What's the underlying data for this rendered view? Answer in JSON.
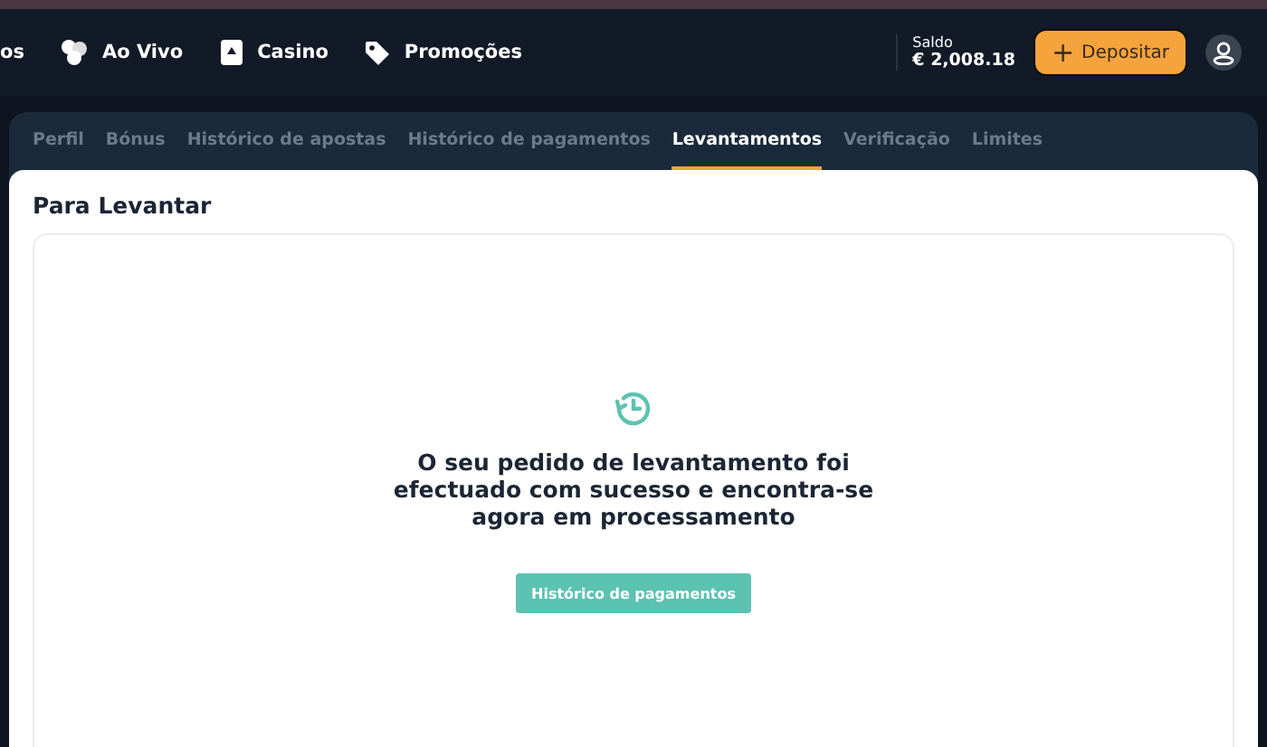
{
  "nav": [
    {
      "label": "os",
      "kind": "plain"
    },
    {
      "label": "Ao Vivo",
      "kind": "live"
    },
    {
      "label": "Casino",
      "kind": "casino"
    },
    {
      "label": "Promoções",
      "kind": "promo"
    }
  ],
  "balance": {
    "label": "Saldo",
    "amount": "€ 2,008.18"
  },
  "deposit_button": {
    "icon": "+",
    "label": "Depositar"
  },
  "tabs": [
    {
      "label": "Perfil",
      "selected": false
    },
    {
      "label": "Bónus",
      "selected": false
    },
    {
      "label": "Histórico de apostas",
      "selected": false
    },
    {
      "label": "Histórico de pagamentos",
      "selected": false
    },
    {
      "label": "Levantamentos",
      "selected": true
    },
    {
      "label": "Verificação",
      "selected": false
    },
    {
      "label": "Limites",
      "selected": false
    }
  ],
  "panel": {
    "title": "Para Levantar",
    "message": "O seu pedido de levantamento foi efectuado com sucesso e encontra-se agora em processamento",
    "button": "Histórico de pagamentos"
  }
}
